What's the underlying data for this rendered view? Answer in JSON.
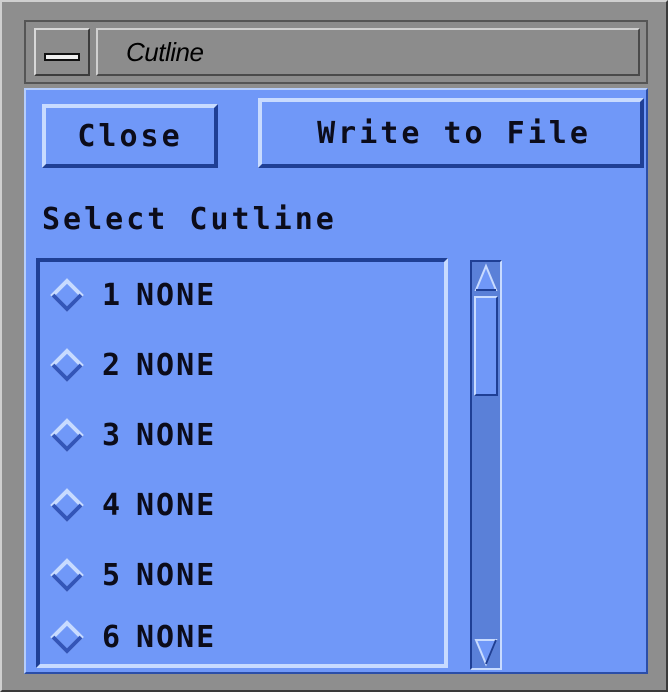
{
  "window": {
    "title": "Cutline"
  },
  "buttons": {
    "close_label": "Close",
    "write_label": "Write to File"
  },
  "section": {
    "label": "Select Cutline"
  },
  "cutlines": [
    {
      "number": "1",
      "value": "NONE"
    },
    {
      "number": "2",
      "value": "NONE"
    },
    {
      "number": "3",
      "value": "NONE"
    },
    {
      "number": "4",
      "value": "NONE"
    },
    {
      "number": "5",
      "value": "NONE"
    },
    {
      "number": "6",
      "value": "NONE"
    }
  ],
  "colors": {
    "panel": "#7098f8",
    "highlight": "#c8dbff",
    "shadow": "#1f3f95",
    "titlebar": "#8c8c8c"
  },
  "icons": {
    "window_menu": "window-menu-icon",
    "radio": "diamond-radio-icon",
    "scroll_up": "arrow-up-icon",
    "scroll_down": "arrow-down-icon"
  }
}
